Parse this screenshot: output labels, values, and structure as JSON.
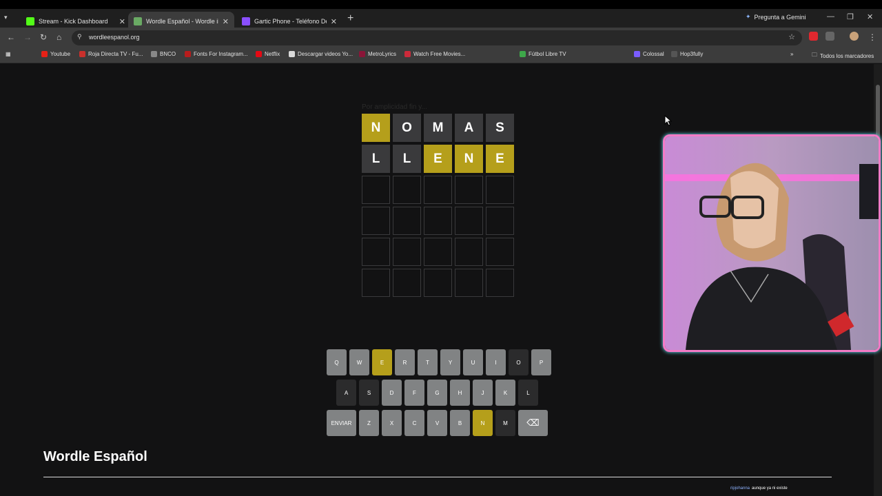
{
  "browser": {
    "tabs": [
      {
        "title": "Stream - Kick Dashboard",
        "favicon_color": "#53fc18",
        "active": false
      },
      {
        "title": "Wordle Español - Wordle ilimitado",
        "favicon_color": "#6aaa64",
        "active": true
      },
      {
        "title": "Gartic Phone - Teléfono Descon...",
        "favicon_color": "#8a4fff",
        "active": false
      }
    ],
    "gemini_label": "Pregunta a Gemini",
    "url": "wordleespanol.org",
    "bookmarks": [
      "Youtube",
      "Roja Directa TV - Fu...",
      "BNCO",
      "Fonts For Instagram...",
      "Netflix",
      "Descargar videos Yo...",
      "MetroLyrics",
      "Watch Free Movies...",
      "Fútbol Libre TV",
      "Colossal",
      "Hop3fully"
    ],
    "all_bookmarks": "Todos los marcadores"
  },
  "game": {
    "hint_text": "Por amplicidad fin y...",
    "board": [
      [
        {
          "l": "N",
          "s": "present"
        },
        {
          "l": "O",
          "s": "absent"
        },
        {
          "l": "M",
          "s": "absent"
        },
        {
          "l": "A",
          "s": "absent"
        },
        {
          "l": "S",
          "s": "absent"
        }
      ],
      [
        {
          "l": "L",
          "s": "absent"
        },
        {
          "l": "L",
          "s": "absent"
        },
        {
          "l": "E",
          "s": "present"
        },
        {
          "l": "N",
          "s": "present"
        },
        {
          "l": "E",
          "s": "present"
        }
      ],
      [
        {
          "l": "",
          "s": "empty"
        },
        {
          "l": "",
          "s": "empty"
        },
        {
          "l": "",
          "s": "empty"
        },
        {
          "l": "",
          "s": "empty"
        },
        {
          "l": "",
          "s": "empty"
        }
      ],
      [
        {
          "l": "",
          "s": "empty"
        },
        {
          "l": "",
          "s": "empty"
        },
        {
          "l": "",
          "s": "empty"
        },
        {
          "l": "",
          "s": "empty"
        },
        {
          "l": "",
          "s": "empty"
        }
      ],
      [
        {
          "l": "",
          "s": "empty"
        },
        {
          "l": "",
          "s": "empty"
        },
        {
          "l": "",
          "s": "empty"
        },
        {
          "l": "",
          "s": "empty"
        },
        {
          "l": "",
          "s": "empty"
        }
      ],
      [
        {
          "l": "",
          "s": "empty"
        },
        {
          "l": "",
          "s": "empty"
        },
        {
          "l": "",
          "s": "empty"
        },
        {
          "l": "",
          "s": "empty"
        },
        {
          "l": "",
          "s": "empty"
        }
      ]
    ],
    "keyboard": [
      [
        {
          "k": "Q",
          "s": "unused"
        },
        {
          "k": "W",
          "s": "unused"
        },
        {
          "k": "E",
          "s": "present"
        },
        {
          "k": "R",
          "s": "unused"
        },
        {
          "k": "T",
          "s": "unused"
        },
        {
          "k": "Y",
          "s": "unused"
        },
        {
          "k": "U",
          "s": "unused"
        },
        {
          "k": "I",
          "s": "unused"
        },
        {
          "k": "O",
          "s": "absent"
        },
        {
          "k": "P",
          "s": "unused"
        }
      ],
      [
        {
          "k": "A",
          "s": "absent"
        },
        {
          "k": "S",
          "s": "absent"
        },
        {
          "k": "D",
          "s": "unused"
        },
        {
          "k": "F",
          "s": "unused"
        },
        {
          "k": "G",
          "s": "unused"
        },
        {
          "k": "H",
          "s": "unused"
        },
        {
          "k": "J",
          "s": "unused"
        },
        {
          "k": "K",
          "s": "unused"
        },
        {
          "k": "L",
          "s": "absent"
        }
      ],
      [
        {
          "k": "ENVIAR",
          "s": "unused"
        },
        {
          "k": "Z",
          "s": "unused"
        },
        {
          "k": "X",
          "s": "unused"
        },
        {
          "k": "C",
          "s": "unused"
        },
        {
          "k": "V",
          "s": "unused"
        },
        {
          "k": "B",
          "s": "unused"
        },
        {
          "k": "N",
          "s": "present"
        },
        {
          "k": "M",
          "s": "absent"
        },
        {
          "k": "⌫",
          "s": "unused"
        }
      ]
    ],
    "colors": {
      "present": "#b59f1b",
      "absent": "#3a3a3c",
      "key_default": "#818384"
    }
  },
  "footer": {
    "title": "Wordle Español"
  },
  "chat": {
    "user": "ripjohanna",
    "message": "aunque ya ni existe"
  }
}
